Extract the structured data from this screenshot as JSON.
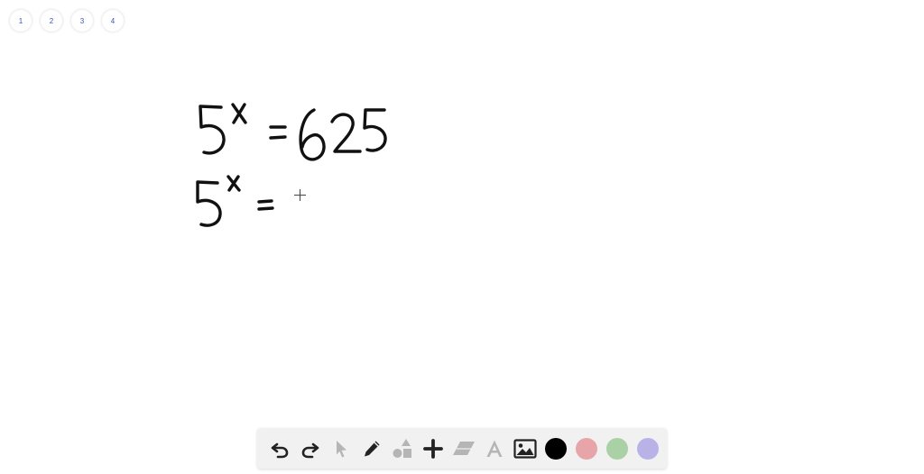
{
  "pages": [
    {
      "label": "1"
    },
    {
      "label": "2"
    },
    {
      "label": "3"
    },
    {
      "label": "4"
    }
  ],
  "toolbar": {
    "tools": [
      {
        "name": "undo-icon",
        "enabled": true
      },
      {
        "name": "redo-icon",
        "enabled": true
      },
      {
        "name": "select-arrow-icon",
        "enabled": false
      },
      {
        "name": "pen-icon",
        "enabled": true
      },
      {
        "name": "shapes-icon",
        "enabled": false
      },
      {
        "name": "plus-icon",
        "enabled": true
      },
      {
        "name": "eraser-icon",
        "enabled": false
      },
      {
        "name": "text-icon",
        "enabled": false
      },
      {
        "name": "image-icon",
        "enabled": true
      }
    ],
    "colors": [
      {
        "name": "black",
        "hex": "#000000",
        "selected": true
      },
      {
        "name": "red",
        "hex": "#e8a5a9"
      },
      {
        "name": "green",
        "hex": "#a9d1a5"
      },
      {
        "name": "purple",
        "hex": "#b9b2e6"
      }
    ]
  },
  "ink_color": "#111111",
  "icon_color": "#222222",
  "disabled_icon_color": "#b5b5b5"
}
